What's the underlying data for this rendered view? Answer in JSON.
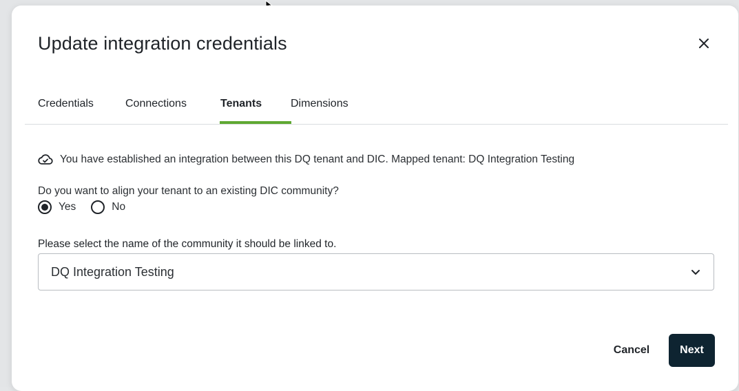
{
  "dialog": {
    "title": "Update integration credentials",
    "close_icon": "close-icon"
  },
  "tabs": [
    {
      "label": "Credentials",
      "active": false
    },
    {
      "label": "Connections",
      "active": false
    },
    {
      "label": "Tenants",
      "active": true
    },
    {
      "label": "Dimensions",
      "active": false
    }
  ],
  "info": {
    "icon": "cloud-check-icon",
    "text": "You have established an integration between this DQ tenant and DIC. Mapped tenant: DQ Integration Testing"
  },
  "alignment": {
    "question": "Do you want to align your tenant to an existing DIC community?",
    "options": [
      {
        "label": "Yes",
        "selected": true
      },
      {
        "label": "No",
        "selected": false
      }
    ]
  },
  "community": {
    "label": "Please select the name of the community it should be linked to.",
    "selected_value": "DQ Integration Testing",
    "chevron_icon": "chevron-down-icon"
  },
  "footer": {
    "cancel_label": "Cancel",
    "next_label": "Next"
  },
  "colors": {
    "accent": "#5fa832",
    "primary_button": "#0e2431"
  }
}
